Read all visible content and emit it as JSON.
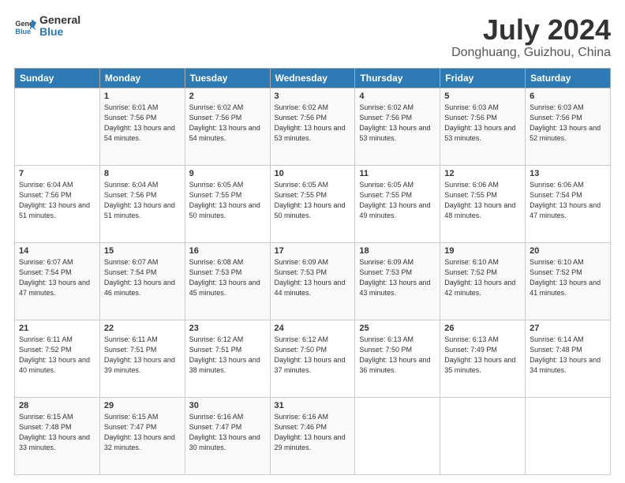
{
  "logo": {
    "line1": "General",
    "line2": "Blue"
  },
  "title": "July 2024",
  "location": "Donghuang, Guizhou, China",
  "weekdays": [
    "Sunday",
    "Monday",
    "Tuesday",
    "Wednesday",
    "Thursday",
    "Friday",
    "Saturday"
  ],
  "weeks": [
    [
      {
        "day": "",
        "empty": true
      },
      {
        "day": "1",
        "sunrise": "6:01 AM",
        "sunset": "7:56 PM",
        "daylight": "13 hours and 54 minutes."
      },
      {
        "day": "2",
        "sunrise": "6:02 AM",
        "sunset": "7:56 PM",
        "daylight": "13 hours and 54 minutes."
      },
      {
        "day": "3",
        "sunrise": "6:02 AM",
        "sunset": "7:56 PM",
        "daylight": "13 hours and 53 minutes."
      },
      {
        "day": "4",
        "sunrise": "6:02 AM",
        "sunset": "7:56 PM",
        "daylight": "13 hours and 53 minutes."
      },
      {
        "day": "5",
        "sunrise": "6:03 AM",
        "sunset": "7:56 PM",
        "daylight": "13 hours and 53 minutes."
      },
      {
        "day": "6",
        "sunrise": "6:03 AM",
        "sunset": "7:56 PM",
        "daylight": "13 hours and 52 minutes."
      }
    ],
    [
      {
        "day": "7",
        "sunrise": "6:04 AM",
        "sunset": "7:56 PM",
        "daylight": "13 hours and 51 minutes."
      },
      {
        "day": "8",
        "sunrise": "6:04 AM",
        "sunset": "7:56 PM",
        "daylight": "13 hours and 51 minutes."
      },
      {
        "day": "9",
        "sunrise": "6:05 AM",
        "sunset": "7:55 PM",
        "daylight": "13 hours and 50 minutes."
      },
      {
        "day": "10",
        "sunrise": "6:05 AM",
        "sunset": "7:55 PM",
        "daylight": "13 hours and 50 minutes."
      },
      {
        "day": "11",
        "sunrise": "6:05 AM",
        "sunset": "7:55 PM",
        "daylight": "13 hours and 49 minutes."
      },
      {
        "day": "12",
        "sunrise": "6:06 AM",
        "sunset": "7:55 PM",
        "daylight": "13 hours and 48 minutes."
      },
      {
        "day": "13",
        "sunrise": "6:06 AM",
        "sunset": "7:54 PM",
        "daylight": "13 hours and 47 minutes."
      }
    ],
    [
      {
        "day": "14",
        "sunrise": "6:07 AM",
        "sunset": "7:54 PM",
        "daylight": "13 hours and 47 minutes."
      },
      {
        "day": "15",
        "sunrise": "6:07 AM",
        "sunset": "7:54 PM",
        "daylight": "13 hours and 46 minutes."
      },
      {
        "day": "16",
        "sunrise": "6:08 AM",
        "sunset": "7:53 PM",
        "daylight": "13 hours and 45 minutes."
      },
      {
        "day": "17",
        "sunrise": "6:09 AM",
        "sunset": "7:53 PM",
        "daylight": "13 hours and 44 minutes."
      },
      {
        "day": "18",
        "sunrise": "6:09 AM",
        "sunset": "7:53 PM",
        "daylight": "13 hours and 43 minutes."
      },
      {
        "day": "19",
        "sunrise": "6:10 AM",
        "sunset": "7:52 PM",
        "daylight": "13 hours and 42 minutes."
      },
      {
        "day": "20",
        "sunrise": "6:10 AM",
        "sunset": "7:52 PM",
        "daylight": "13 hours and 41 minutes."
      }
    ],
    [
      {
        "day": "21",
        "sunrise": "6:11 AM",
        "sunset": "7:52 PM",
        "daylight": "13 hours and 40 minutes."
      },
      {
        "day": "22",
        "sunrise": "6:11 AM",
        "sunset": "7:51 PM",
        "daylight": "13 hours and 39 minutes."
      },
      {
        "day": "23",
        "sunrise": "6:12 AM",
        "sunset": "7:51 PM",
        "daylight": "13 hours and 38 minutes."
      },
      {
        "day": "24",
        "sunrise": "6:12 AM",
        "sunset": "7:50 PM",
        "daylight": "13 hours and 37 minutes."
      },
      {
        "day": "25",
        "sunrise": "6:13 AM",
        "sunset": "7:50 PM",
        "daylight": "13 hours and 36 minutes."
      },
      {
        "day": "26",
        "sunrise": "6:13 AM",
        "sunset": "7:49 PM",
        "daylight": "13 hours and 35 minutes."
      },
      {
        "day": "27",
        "sunrise": "6:14 AM",
        "sunset": "7:48 PM",
        "daylight": "13 hours and 34 minutes."
      }
    ],
    [
      {
        "day": "28",
        "sunrise": "6:15 AM",
        "sunset": "7:48 PM",
        "daylight": "13 hours and 33 minutes."
      },
      {
        "day": "29",
        "sunrise": "6:15 AM",
        "sunset": "7:47 PM",
        "daylight": "13 hours and 32 minutes."
      },
      {
        "day": "30",
        "sunrise": "6:16 AM",
        "sunset": "7:47 PM",
        "daylight": "13 hours and 30 minutes."
      },
      {
        "day": "31",
        "sunrise": "6:16 AM",
        "sunset": "7:46 PM",
        "daylight": "13 hours and 29 minutes."
      },
      {
        "day": "",
        "empty": true
      },
      {
        "day": "",
        "empty": true
      },
      {
        "day": "",
        "empty": true
      }
    ]
  ]
}
